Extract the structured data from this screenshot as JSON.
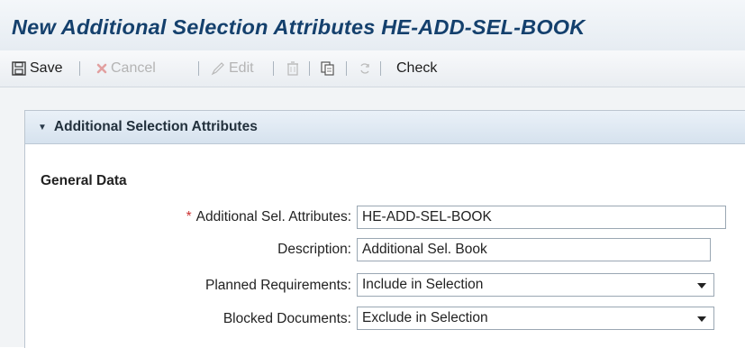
{
  "page": {
    "title": "New Additional Selection Attributes HE-ADD-SEL-BOOK"
  },
  "toolbar": {
    "save_label": "Save",
    "cancel_label": "Cancel",
    "edit_label": "Edit",
    "check_label": "Check",
    "icons": [
      "save-icon",
      "cancel-icon",
      "edit-icon",
      "delete-icon",
      "copy-icon",
      "refresh-icon"
    ]
  },
  "panel": {
    "title": "Additional Selection Attributes",
    "section_title": "General Data",
    "fields": [
      {
        "label": "Additional Sel. Attributes:",
        "value": "HE-ADD-SEL-BOOK",
        "required": true
      },
      {
        "label": "Description:",
        "value": "Additional Sel. Book",
        "required": false
      },
      {
        "label": "Planned Requirements:",
        "value": "Include in Selection",
        "type": "dropdown"
      },
      {
        "label": "Blocked Documents:",
        "value": "Exclude in Selection",
        "type": "dropdown"
      }
    ]
  },
  "colors": {
    "title": "#14406d",
    "required_marker": "#cc3333",
    "panel_header": "#d6e2ee"
  }
}
